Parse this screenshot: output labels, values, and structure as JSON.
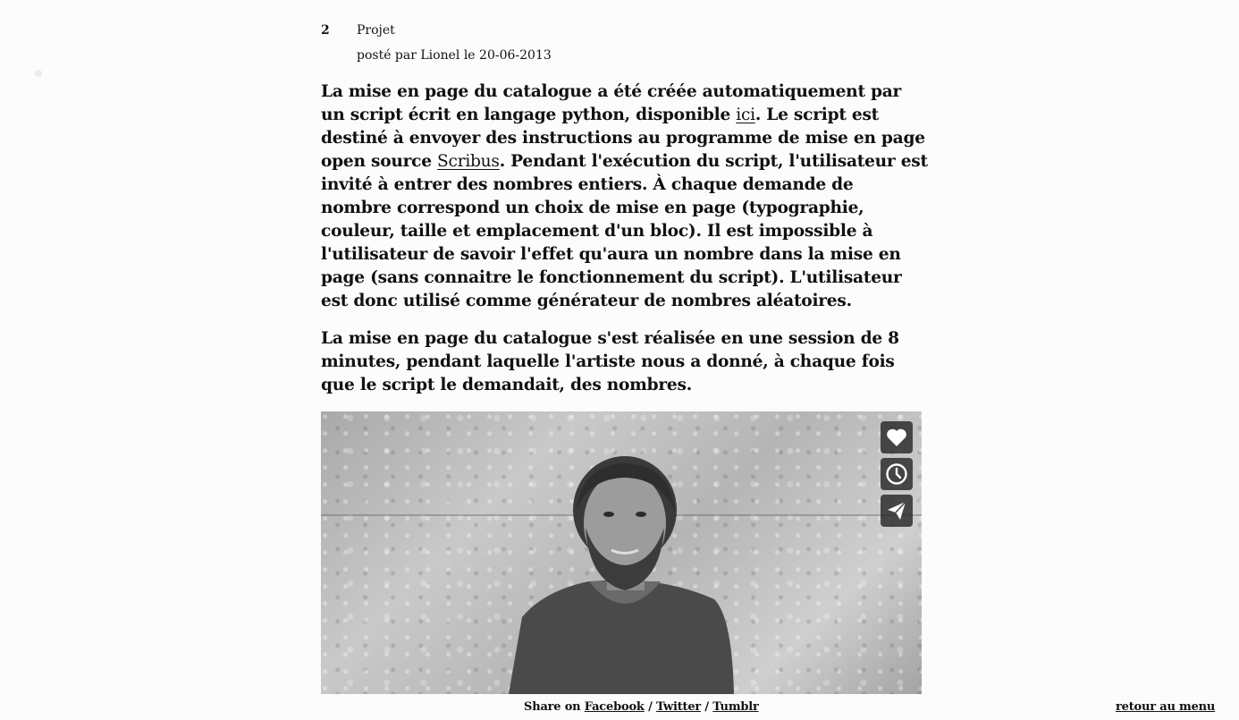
{
  "post": {
    "number": "2",
    "title": "Projet",
    "meta": "posté par Lionel le 20-06-2013"
  },
  "body": {
    "p1_before_ici": "La mise en page du catalogue a été créée automatiquement par un script écrit en langage python, disponible ",
    "ici_link": "ici",
    "p1_after_ici": ". Le script est destiné à envoyer des instructions au programme de mise en page open source ",
    "scribus_link": "Scribus",
    "p1_rest": ". Pendant l'exécution du script, l'utilisateur est invité à entrer des nombres entiers. À chaque demande de nombre correspond un choix de mise en page (typographie, couleur, taille et emplacement d'un bloc). Il est impossible à l'utilisateur de savoir l'effet qu'aura un nombre dans la mise en page (sans connaitre le fonctionnement du script). L'utilisateur est donc utilisé comme générateur de nombres aléatoires.",
    "p2": "La mise en page du catalogue s'est réalisée en une session de 8 minutes, pendant laquelle l'artiste nous a donné, à chaque fois que le script le demandait, des nombres."
  },
  "video": {
    "buttons": [
      "heart-icon",
      "clock-icon",
      "send-icon"
    ]
  },
  "share": {
    "prefix": "Share on",
    "facebook": "Facebook",
    "sep1": "/",
    "twitter": "Twitter",
    "sep2": "/",
    "tumblr": "Tumblr"
  },
  "footer": {
    "back_label": "retour au menu"
  }
}
